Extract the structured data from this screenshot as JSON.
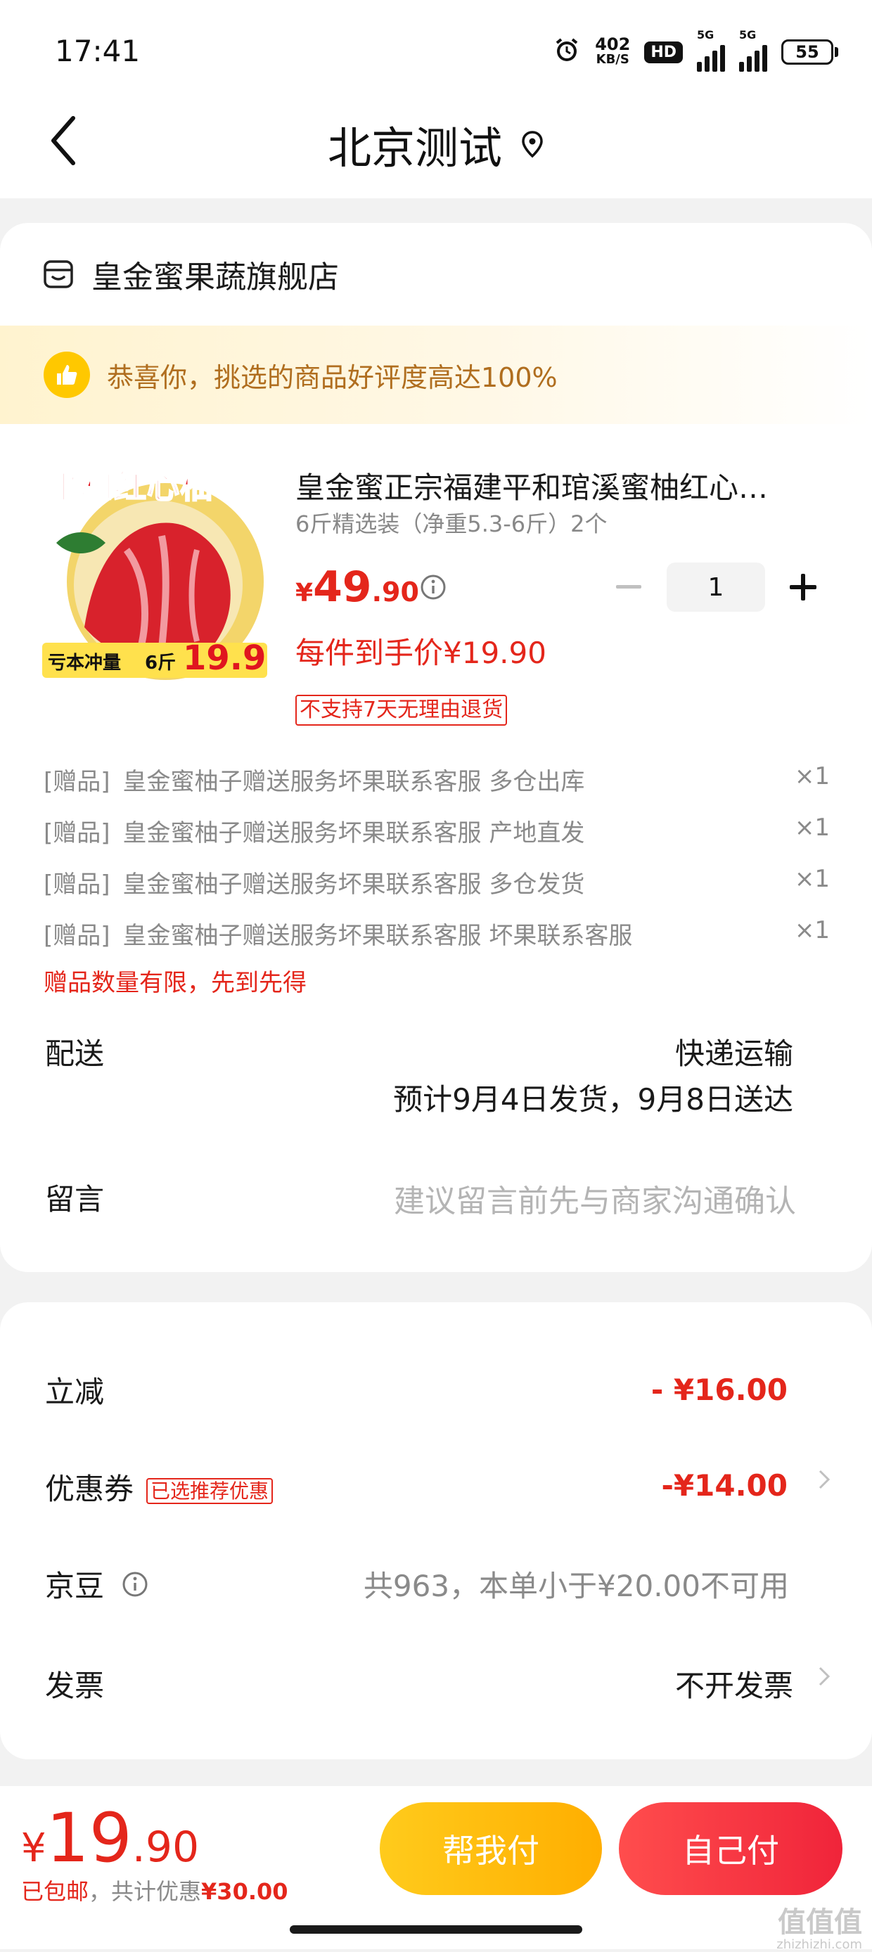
{
  "status_bar": {
    "time": "17:41",
    "net_speed_value": "402",
    "net_speed_unit": "KB/S",
    "hd_label": "HD",
    "signal1_label": "5G",
    "signal2_label": "5G",
    "battery": "55"
  },
  "header": {
    "title": "北京测试"
  },
  "shop": {
    "name": "皇金蜜果蔬旗舰店"
  },
  "banner": {
    "text": "恭喜你，挑选的商品好评度高达100%"
  },
  "product": {
    "image_text_top": "平和红心柚",
    "image_text_bottom_left": "亏本冲量",
    "image_text_bottom_mid": "6斤",
    "image_text_bottom_price": "19.9",
    "title": "皇金蜜正宗福建平和琯溪蜜柚红心…",
    "spec": "6斤精选装（净重5.3-6斤）2个",
    "price_yen": "¥",
    "price_int": "49",
    "price_dec": ".90",
    "quantity": "1",
    "final_price": "每件到手价¥19.90",
    "return_policy": "不支持7天无理由退货"
  },
  "gifts": [
    {
      "tag": "[赠品]",
      "name": "皇金蜜柚子赠送服务坏果联系客服 多仓出库",
      "qty": "×1"
    },
    {
      "tag": "[赠品]",
      "name": "皇金蜜柚子赠送服务坏果联系客服 产地直发",
      "qty": "×1"
    },
    {
      "tag": "[赠品]",
      "name": "皇金蜜柚子赠送服务坏果联系客服 多仓发货",
      "qty": "×1"
    },
    {
      "tag": "[赠品]",
      "name": "皇金蜜柚子赠送服务坏果联系客服 坏果联系客服",
      "qty": "×1"
    }
  ],
  "gift_note": "赠品数量有限，先到先得",
  "delivery": {
    "label": "配送",
    "method": "快递运输",
    "eta": "预计9月4日发货，9月8日送达"
  },
  "message": {
    "label": "留言",
    "placeholder": "建议留言前先与商家沟通确认"
  },
  "payment": {
    "instant_discount_label": "立减",
    "instant_discount_value": "- ¥16.00",
    "coupon_label": "优惠券",
    "coupon_tag": "已选推荐优惠",
    "coupon_value": "-¥14.00",
    "beans_label": "京豆",
    "beans_value": "共963，本单小于¥20.00不可用",
    "invoice_label": "发票",
    "invoice_value": "不开发票"
  },
  "footer": {
    "total_yen": "¥",
    "total_int": "19",
    "total_dec": ".90",
    "shipping": "已包邮",
    "saving_prefix": "，共计优惠",
    "saving_value": "¥30.00",
    "help_pay": "帮我付",
    "self_pay": "自己付",
    "watermark_cn": "值值值",
    "watermark_url": "zhizhizhi.com"
  },
  "colors": {
    "accent_red": "#e4261b",
    "banner_text": "#b06e1f",
    "yellow_button": "#ffb800"
  }
}
